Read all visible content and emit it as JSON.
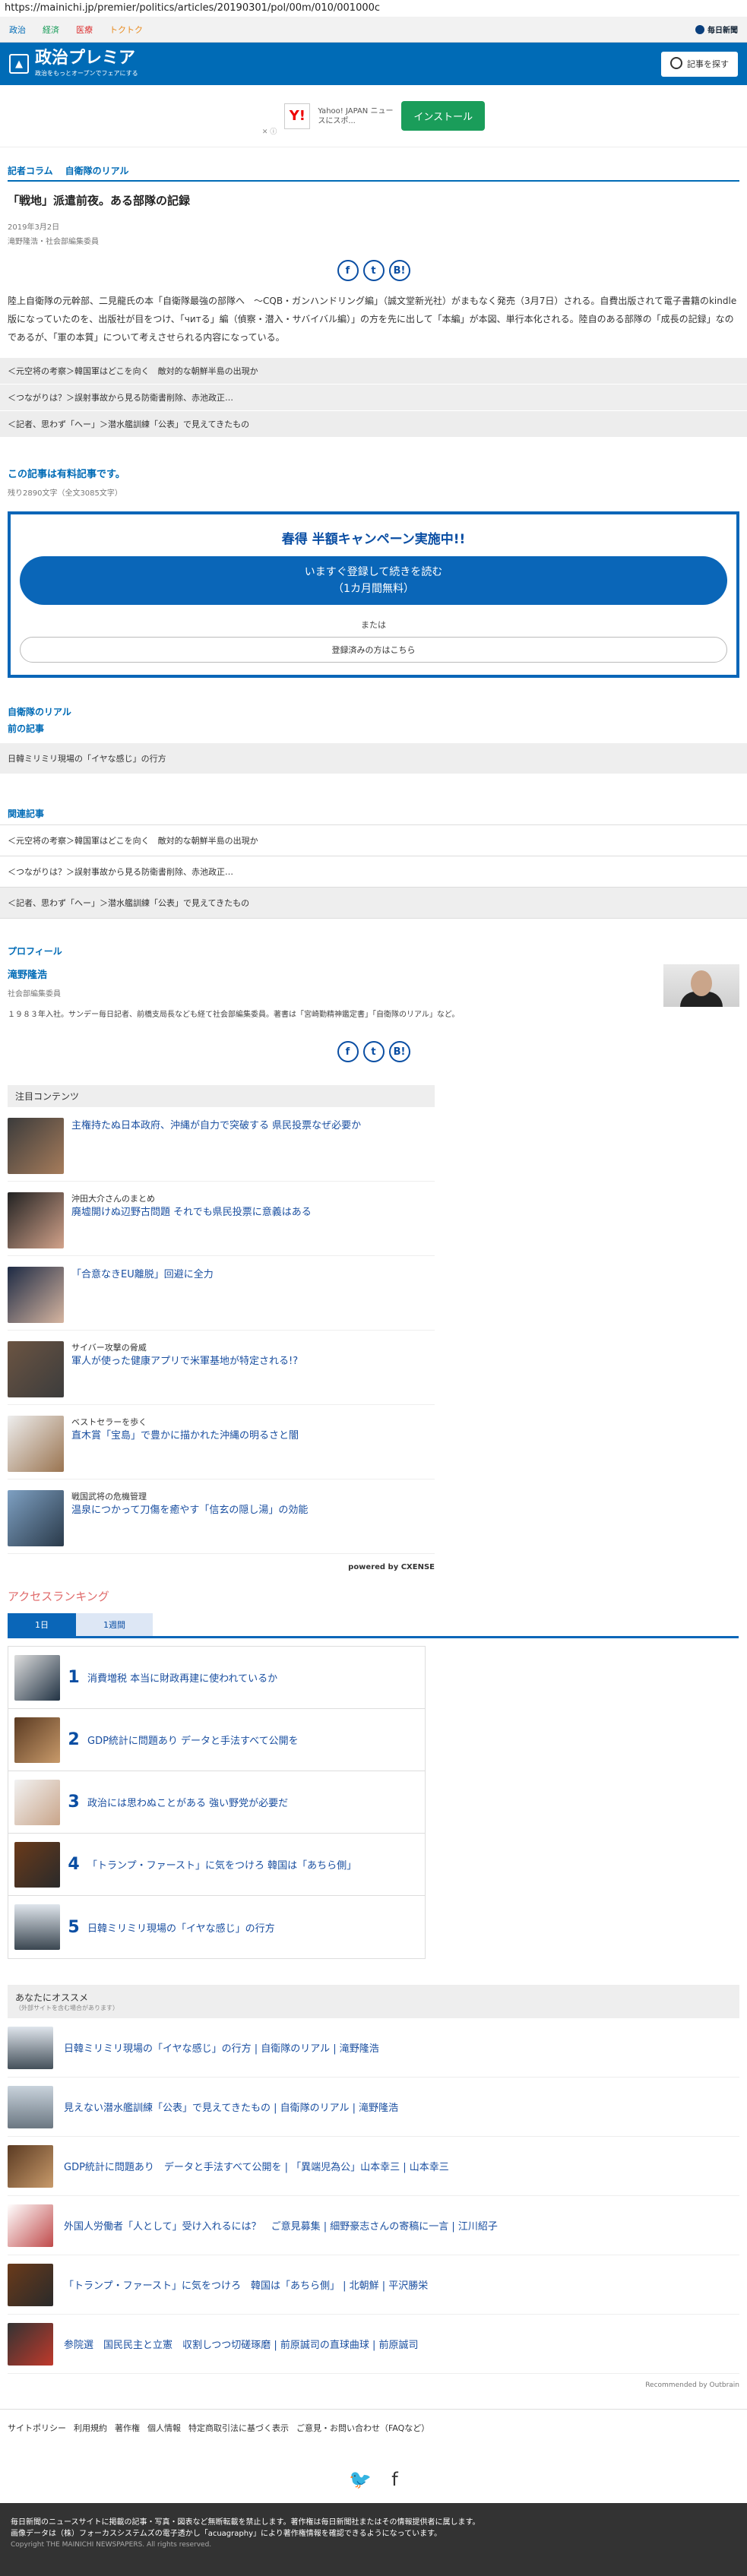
{
  "browser": {
    "url": "https://mainichi.jp/premier/politics/articles/20190301/pol/00m/010/001000c"
  },
  "topnav": {
    "links": [
      "政治",
      "経済",
      "医療",
      "トクトク"
    ],
    "logo": "毎日新聞"
  },
  "brand": {
    "title": "政治プレミア",
    "subtitle": "政治をもっとオープンでフェアにする",
    "search_label": "記事を探す"
  },
  "ad": {
    "brand": "Y!",
    "text": "Yahoo! JAPAN ニュースにスポ...",
    "install": "インストール",
    "mark": "✕ ⓘ"
  },
  "article": {
    "category": "記者コラム",
    "series": "自衛隊のリアル",
    "title": "「戦地」派遣前夜。ある部隊の記録",
    "date": "2019年3月2日",
    "author": "滝野隆浩・社会部編集委員",
    "lead": "陸上自衛隊の元幹部、二見龍氏の本「自衛隊最強の部隊へ　～CQB・ガンハンドリング編」（誠文堂新光社）がまもなく発売（3月7日）される。自費出版されて電子書籍のkindle版になっていたのを、出版社が目をつけ、「читる」編（偵察・潜入・サバイバル編）」の方を先に出して「本編」が本図、単行本化される。陸自のある部隊の「成長の記録」なのであるが、「軍の本質」について考えさせられる内容になっている。"
  },
  "share": {
    "facebook": "f",
    "twitter": "t",
    "hatena": "B!"
  },
  "related_top": [
    "＜元空将の考察＞韓国軍はどこを向く　敵対的な朝鮮半島の出現か",
    "＜つながりは？＞誤射事故から見る防衛書削除、赤池政正…",
    "＜記者、思わず「へー」＞潜水艦訓練「公表」で見えてきたもの"
  ],
  "paid": {
    "heading": "この記事は有料記事です。",
    "remaining": "残り2890文字（全文3085文字）"
  },
  "campaign": {
    "headline": "春得 半額キャンペーン実施中!!",
    "register_line1": "いますぐ登録して続きを読む",
    "register_line2": "（1カ月間無料）",
    "or": "または",
    "login": "登録済みの方はこちら"
  },
  "series_nav": {
    "series_label": "自衛隊のリアル",
    "prev_label": "前の記事",
    "prev_title": "日韓ミリミリ現場の「イヤな感じ」の行方"
  },
  "related": {
    "heading": "関連記事",
    "items": [
      "＜元空将の考察＞韓国軍はどこを向く　敵対的な朝鮮半島の出現か",
      "＜つながりは？＞誤射事故から見る防衛書削除、赤池政正…",
      "＜記者、思わず「へー」＞潜水艦訓練「公表」で見えてきたもの"
    ]
  },
  "profile": {
    "heading": "プロフィール",
    "name": "滝野隆浩",
    "role": "社会部編集委員",
    "bio": "１９８３年入社。サンデー毎日記者、前橋支局長なども経て社会部編集委員。著書は「宮崎勤精神鑑定書」「自衛隊のリアル」など。"
  },
  "notable": {
    "heading": "注目コンテンツ",
    "items": [
      {
        "pre": "",
        "title": "主権持たぬ日本政府、沖縄が自力で突破する 県民投票なぜ必要か"
      },
      {
        "pre": "沖田大介さんのまとめ",
        "title": "廃墟開けぬ辺野古問題 それでも県民投票に意義はある"
      },
      {
        "pre": "",
        "title": "「合意なきEU離脱」回避に全力"
      },
      {
        "pre": "サイバー攻撃の脅威",
        "title": "軍人が使った健康アプリで米軍基地が特定される!?"
      },
      {
        "pre": "ベストセラーを歩く",
        "title": "直木賞「宝島」で豊かに描かれた沖縄の明るさと闇"
      },
      {
        "pre": "戦国武将の危機管理",
        "title": "温泉につかって刀傷を癒やす「信玄の隠し湯」の効能"
      }
    ],
    "powered": "powered by CXENSE"
  },
  "ranking": {
    "heading": "アクセスランキング",
    "tabs": [
      "1日",
      "1週間"
    ],
    "items": [
      {
        "rank": "1",
        "title": "消費増税 本当に財政再建に使われているか"
      },
      {
        "rank": "2",
        "title": "GDP統計に問題あり データと手法すべて公開を"
      },
      {
        "rank": "3",
        "title": "政治には思わぬことがある 強い野党が必要だ"
      },
      {
        "rank": "4",
        "title": "「トランプ・ファースト」に気をつけろ 韓国は「あちら側」"
      },
      {
        "rank": "5",
        "title": "日韓ミリミリ現場の「イヤな感じ」の行方"
      }
    ]
  },
  "recommend": {
    "heading": "あなたにオススメ",
    "note": "（外部サイトを含む場合があります）",
    "items": [
      "日韓ミリミリ現場の「イヤな感じ」の行方 | 自衛隊のリアル | 滝野隆浩",
      "見えない潜水艦訓練「公表」で見えてきたもの | 自衛隊のリアル | 滝野隆浩",
      "GDP統計に問題あり　データと手法すべて公開を | 「異端児為公」山本幸三 | 山本幸三",
      "外国人労働者「人として」受け入れるには？　ご意見募集 | 細野豪志さんの寄稿に一言 | 江川紹子",
      "「トランプ・ファースト」に気をつけろ　韓国は「あちら側」 | 北朝鮮 | 平沢勝栄",
      "参院選　国民民主と立憲　収割しつつ切磋琢磨 | 前原誠司の直球曲球 | 前原誠司"
    ],
    "outbrain": "Recommended by Outbrain"
  },
  "footer": {
    "links": [
      "サイトポリシー",
      "利用規約",
      "著作権",
      "個人情報",
      "特定商取引法に基づく表示",
      "ご意見・お問い合わせ（FAQなど）"
    ],
    "notice": "毎日新聞のニュースサイトに掲載の記事・写真・図表など無断転載を禁止します。著作権は毎日新聞社またはその情報提供者に属します。",
    "data": "画像データは（株）フォーカスシステムズの電子透かし「acuagraphy」により著作権情報を確認できるようになっています。",
    "copyright": "Copyright THE MAINICHI NEWSPAPERS. All rights reserved."
  }
}
